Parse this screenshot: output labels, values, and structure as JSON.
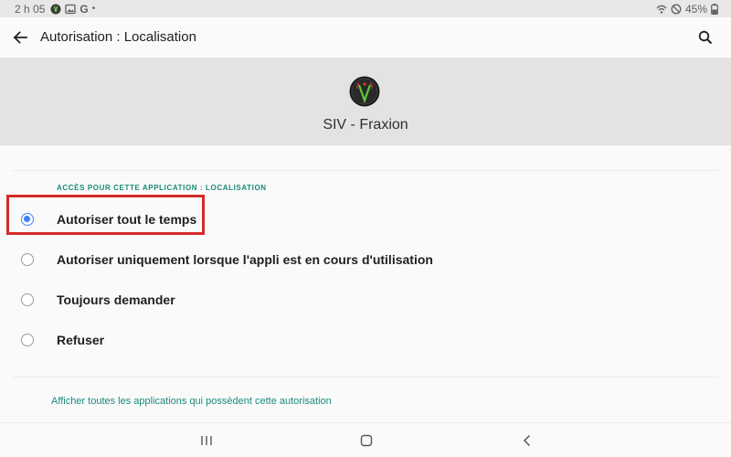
{
  "status_bar": {
    "time": "2 h 05",
    "dot": "•",
    "g_label": "G",
    "battery": "45%"
  },
  "app_bar": {
    "title": "Autorisation : Localisation"
  },
  "app_header": {
    "name": "SIV - Fraxion"
  },
  "section": {
    "header": "ACCÈS POUR CETTE APPLICATION : LOCALISATION"
  },
  "options": [
    {
      "label": "Autoriser tout le temps",
      "selected": true
    },
    {
      "label": "Autoriser uniquement lorsque l'appli est en cours d'utilisation",
      "selected": false
    },
    {
      "label": "Toujours demander",
      "selected": false
    },
    {
      "label": "Refuser",
      "selected": false
    }
  ],
  "footer": {
    "link": "Afficher toutes les applications qui possèdent cette autorisation"
  },
  "colors": {
    "accent": "#3e82f7",
    "section_text": "#1a8a7a",
    "highlight": "#d52b2b",
    "header_bg": "#e3e3e3"
  }
}
